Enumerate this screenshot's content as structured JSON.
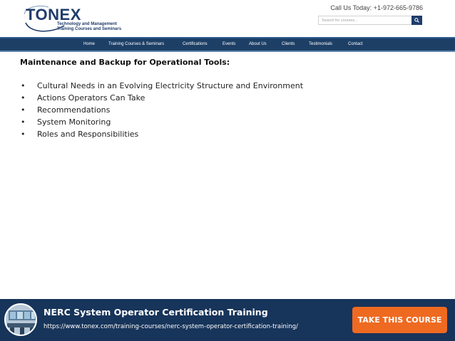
{
  "header": {
    "logo": {
      "wordmark": "TONEX",
      "tagline_1": "Technology and Management",
      "tagline_2": "Training Courses and Seminars"
    },
    "phone": "Call Us Today: +1-972-665-9786",
    "search": {
      "placeholder": "Search for courses...",
      "button_icon": "search-icon"
    }
  },
  "nav": {
    "items": [
      "Home",
      "Training Courses & Seminars",
      "Certifications",
      "Events",
      "About Us",
      "Clients",
      "Testimonials",
      "Contact"
    ]
  },
  "main": {
    "title": "Maintenance and Backup for Operational Tools:",
    "bullet_char": "•",
    "bullets": [
      "Cultural Needs in an Evolving Electricity Structure and Environment",
      "Actions Operators Can Take",
      "Recommendations",
      "System Monitoring",
      "Roles and Responsibilities"
    ]
  },
  "footer": {
    "title": "NERC System Operator Certification Training",
    "url": "https://www.tonex.com/training-courses/nerc-system-operator-certification-training/",
    "cta_label": "TAKE THIS COURSE"
  },
  "colors": {
    "brand_navy": "#1f3c6b",
    "nav_bg": "#1d3f66",
    "footer_bg": "#17345a",
    "cta_orange": "#ee6a21"
  }
}
